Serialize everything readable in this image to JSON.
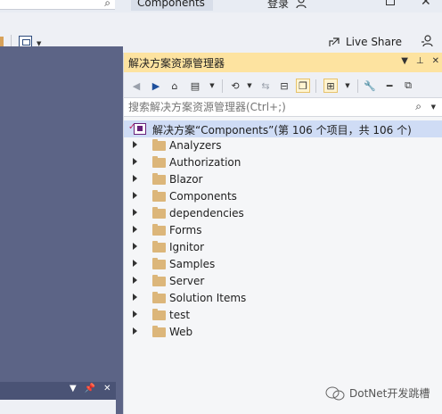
{
  "title_bar": {
    "app_title": "Components",
    "account_label": "登录"
  },
  "toolbar": {
    "live_share_label": "Live Share"
  },
  "solution_explorer": {
    "title": "解决方案资源管理器",
    "search_placeholder": "搜索解决方案资源管理器(Ctrl+;)",
    "root_label": "解决方案“Components”(第 106 个项目，共 106 个)",
    "folders": [
      {
        "label": "Analyzers"
      },
      {
        "label": "Authorization"
      },
      {
        "label": "Blazor"
      },
      {
        "label": "Components"
      },
      {
        "label": "dependencies"
      },
      {
        "label": "Forms"
      },
      {
        "label": "Ignitor"
      },
      {
        "label": "Samples"
      },
      {
        "label": "Server"
      },
      {
        "label": "Solution Items"
      },
      {
        "label": "test"
      },
      {
        "label": "Web"
      }
    ]
  },
  "watermark": {
    "text": "DotNet开发跳槽"
  },
  "colors": {
    "title_active": "#fde3a0",
    "editor_bg": "#5c6486",
    "folder": "#dcb67a",
    "selection": "#cfdcf5"
  }
}
